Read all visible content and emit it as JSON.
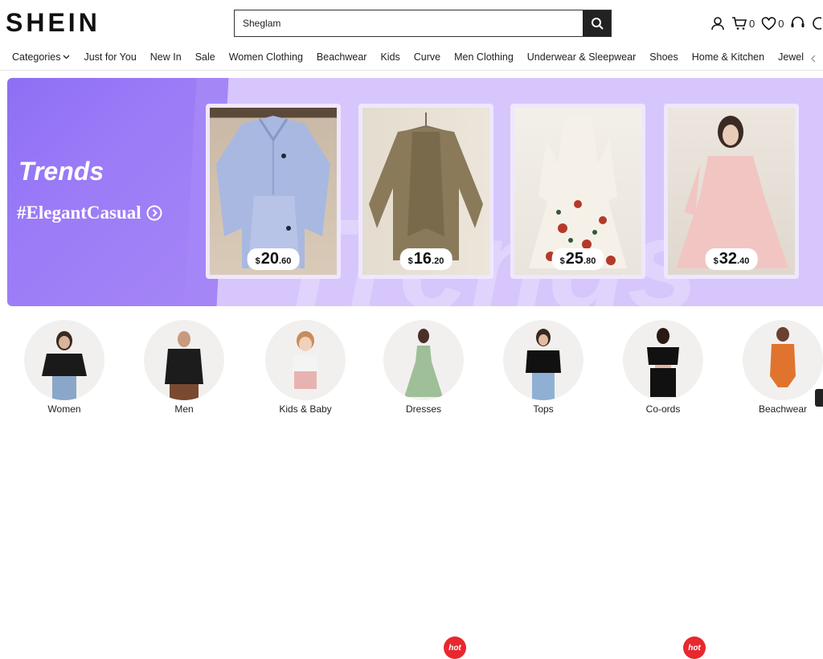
{
  "header": {
    "logo": "SHEIN",
    "search": {
      "value": "Sheglam",
      "placeholder": ""
    },
    "cart_count": "0",
    "wishlist_count": "0"
  },
  "nav": {
    "items": [
      "Categories",
      "Just for You",
      "New In",
      "Sale",
      "Women Clothing",
      "Beachwear",
      "Kids",
      "Curve",
      "Men Clothing",
      "Underwear & Sleepwear",
      "Shoes",
      "Home & Kitchen",
      "Jewelry & Accessories"
    ]
  },
  "banner": {
    "title": "Trends",
    "hashtag": "#ElegantCasual",
    "background_word": "Trends",
    "products": [
      {
        "name": "blue striped shirt set",
        "currency": "$",
        "price_int": "20",
        "price_dec": ".60"
      },
      {
        "name": "olive oversized coat",
        "currency": "$",
        "price_int": "16",
        "price_dec": ".20"
      },
      {
        "name": "floral print maxi dress",
        "currency": "$",
        "price_int": "25",
        "price_dec": ".80"
      },
      {
        "name": "pink off-shoulder dress",
        "currency": "$",
        "price_int": "32",
        "price_dec": ".40"
      }
    ]
  },
  "categories": [
    {
      "label": "Women",
      "hot": false
    },
    {
      "label": "Men",
      "hot": false
    },
    {
      "label": "Kids & Baby",
      "hot": false
    },
    {
      "label": "Dresses",
      "hot": true
    },
    {
      "label": "Tops",
      "hot": false
    },
    {
      "label": "Co-ords",
      "hot": true
    },
    {
      "label": "Beachwear",
      "hot": false
    }
  ],
  "hot_badge": "hot",
  "colors": {
    "accent_purple": "#9b7bf7",
    "hot_red": "#e8272e",
    "text": "#222222"
  },
  "icons": [
    "search-icon",
    "user-icon",
    "cart-icon",
    "heart-icon",
    "support-icon",
    "chevron-down-icon",
    "chevron-left-icon",
    "arrow-circle-right-icon"
  ]
}
